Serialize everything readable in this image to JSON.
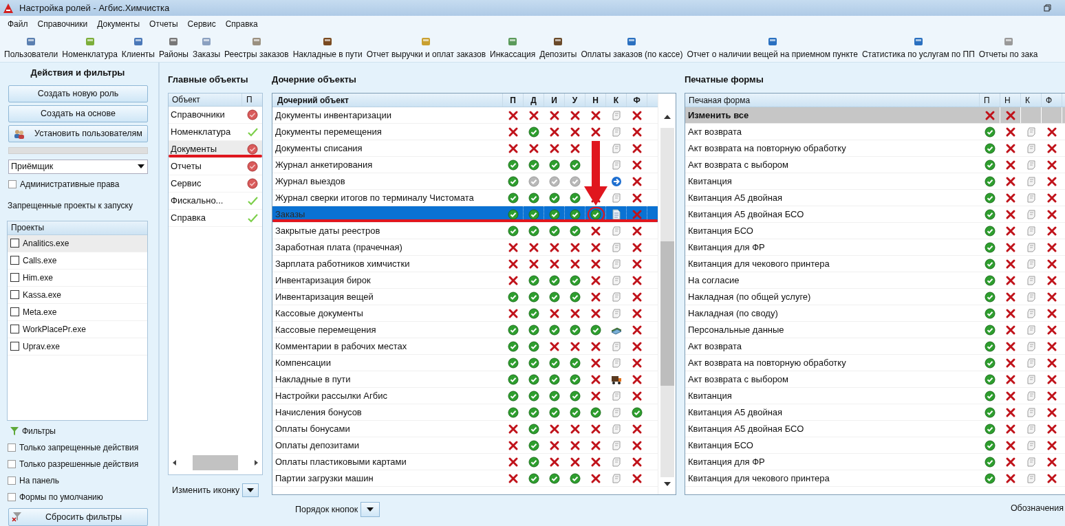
{
  "window": {
    "title": "Настройка ролей - Агбис.Химчистка"
  },
  "menu": [
    "Файл",
    "Справочники",
    "Документы",
    "Отчеты",
    "Сервис",
    "Справка"
  ],
  "toolbar": [
    "Пользователи",
    "Номенклатура",
    "Клиенты",
    "Районы",
    "Заказы",
    "Реестры заказов",
    "Накладные в пути",
    "Отчет выручки и оплат заказов",
    "Инкассация",
    "Депозиты",
    "Оплаты заказов (по кассе)",
    "Отчет о наличии вещей на приемном пункте",
    "Статистика по услугам по ПП",
    "Отчеты по зака"
  ],
  "actions_panel": {
    "title": "Действия и фильтры",
    "buttons": [
      {
        "label": "Создать новую роль",
        "kind": "plain"
      },
      {
        "label": "Создать на основе",
        "kind": "plain"
      },
      {
        "label": "Установить пользователям",
        "kind": "users"
      }
    ],
    "progress": {
      "level": 0
    },
    "role_select": {
      "value": "Приёмщик"
    },
    "admin_rights": {
      "label": "Административные права",
      "checked": false
    },
    "projects_label": "Запрещенные проекты к запуску",
    "projects": {
      "header": "Проекты",
      "items": [
        {
          "label": "Analitics.exe",
          "checked": false,
          "selected": true
        },
        {
          "label": "Calls.exe",
          "checked": false,
          "selected": false
        },
        {
          "label": "Him.exe",
          "checked": false,
          "selected": false
        },
        {
          "label": "Kassa.exe",
          "checked": false,
          "selected": false
        },
        {
          "label": "Meta.exe",
          "checked": false,
          "selected": false
        },
        {
          "label": "WorkPlacePr.exe",
          "checked": false,
          "selected": false
        },
        {
          "label": "Uprav.exe",
          "checked": false,
          "selected": false
        }
      ]
    },
    "filters": {
      "title": "Фильтры",
      "options": [
        {
          "label": "Только запрещенные действия",
          "checked": false
        },
        {
          "label": "Только разрешенные действия",
          "checked": false
        },
        {
          "label": "На панель",
          "checked": false
        },
        {
          "label": "Формы по умолчанию",
          "checked": false
        }
      ]
    },
    "reset_button": "Сбросить фильтры"
  },
  "main_objects": {
    "title": "Главные объекты",
    "columns": [
      "Объект",
      "П"
    ],
    "rows": [
      {
        "name": "Справочники",
        "allowed": false,
        "selected": false,
        "underlined": false
      },
      {
        "name": "Номенклатура",
        "allowed": true,
        "selected": false,
        "underlined": false
      },
      {
        "name": "Документы",
        "allowed": false,
        "selected": true,
        "underlined": true
      },
      {
        "name": "Отчеты",
        "allowed": false,
        "selected": false,
        "underlined": false
      },
      {
        "name": "Сервис",
        "allowed": false,
        "selected": false,
        "underlined": false
      },
      {
        "name": "Фискально...",
        "allowed": true,
        "selected": false,
        "underlined": false
      },
      {
        "name": "Справка",
        "allowed": true,
        "selected": false,
        "underlined": false
      }
    ],
    "change_icon_label": "Изменить иконку"
  },
  "child_objects": {
    "title": "Дочерние объекты",
    "columns": [
      "Дочерний объект",
      "П",
      "Д",
      "И",
      "У",
      "Н",
      "К",
      "Ф"
    ],
    "rows": [
      {
        "name": "Документы инвентаризации",
        "selected": false,
        "underlined": false,
        "cells": [
          {
            "kind": "no"
          },
          {
            "kind": "no"
          },
          {
            "kind": "no"
          },
          {
            "kind": "no"
          },
          {
            "kind": "no"
          },
          {
            "kind": "scroll"
          },
          {
            "kind": "no"
          }
        ]
      },
      {
        "name": "Документы перемещения",
        "selected": false,
        "underlined": false,
        "cells": [
          {
            "kind": "no"
          },
          {
            "kind": "yes"
          },
          {
            "kind": "no"
          },
          {
            "kind": "no"
          },
          {
            "kind": "no"
          },
          {
            "kind": "scroll"
          },
          {
            "kind": "no"
          }
        ]
      },
      {
        "name": "Документы списания",
        "selected": false,
        "underlined": false,
        "cells": [
          {
            "kind": "no"
          },
          {
            "kind": "no"
          },
          {
            "kind": "no"
          },
          {
            "kind": "no"
          },
          {
            "kind": "none"
          },
          {
            "kind": "scroll"
          },
          {
            "kind": "no"
          }
        ]
      },
      {
        "name": "Журнал анкетирования",
        "selected": false,
        "underlined": false,
        "cells": [
          {
            "kind": "yes"
          },
          {
            "kind": "yes"
          },
          {
            "kind": "yes"
          },
          {
            "kind": "yes"
          },
          {
            "kind": "none"
          },
          {
            "kind": "scroll"
          },
          {
            "kind": "no"
          }
        ]
      },
      {
        "name": "Журнал выездов",
        "selected": false,
        "underlined": false,
        "cells": [
          {
            "kind": "yes"
          },
          {
            "kind": "grey"
          },
          {
            "kind": "grey"
          },
          {
            "kind": "grey"
          },
          {
            "kind": "none"
          },
          {
            "kind": "arrow"
          },
          {
            "kind": "no"
          }
        ]
      },
      {
        "name": "Журнал сверки итогов по терминалу Чистомата",
        "selected": false,
        "underlined": false,
        "cells": [
          {
            "kind": "yes"
          },
          {
            "kind": "yes"
          },
          {
            "kind": "yes"
          },
          {
            "kind": "yes"
          },
          {
            "kind": "no"
          },
          {
            "kind": "scroll"
          },
          {
            "kind": "no"
          }
        ]
      },
      {
        "name": "Заказы",
        "selected": true,
        "underlined": true,
        "cells": [
          {
            "kind": "yes"
          },
          {
            "kind": "yes"
          },
          {
            "kind": "yes"
          },
          {
            "kind": "yes"
          },
          {
            "kind": "yes_marked"
          },
          {
            "kind": "doc"
          },
          {
            "kind": "no"
          }
        ]
      },
      {
        "name": "Закрытые даты реестров",
        "selected": false,
        "underlined": false,
        "cells": [
          {
            "kind": "yes"
          },
          {
            "kind": "yes"
          },
          {
            "kind": "yes"
          },
          {
            "kind": "yes"
          },
          {
            "kind": "no"
          },
          {
            "kind": "scroll"
          },
          {
            "kind": "no"
          }
        ]
      },
      {
        "name": "Заработная плата (прачечная)",
        "selected": false,
        "underlined": false,
        "cells": [
          {
            "kind": "no"
          },
          {
            "kind": "no"
          },
          {
            "kind": "no"
          },
          {
            "kind": "no"
          },
          {
            "kind": "no"
          },
          {
            "kind": "scroll"
          },
          {
            "kind": "no"
          }
        ]
      },
      {
        "name": "Зарплата работников химчистки",
        "selected": false,
        "underlined": false,
        "cells": [
          {
            "kind": "no"
          },
          {
            "kind": "no"
          },
          {
            "kind": "no"
          },
          {
            "kind": "no"
          },
          {
            "kind": "no"
          },
          {
            "kind": "scroll"
          },
          {
            "kind": "no"
          }
        ]
      },
      {
        "name": "Инвентаризация бирок",
        "selected": false,
        "underlined": false,
        "cells": [
          {
            "kind": "no"
          },
          {
            "kind": "yes"
          },
          {
            "kind": "yes"
          },
          {
            "kind": "yes"
          },
          {
            "kind": "no"
          },
          {
            "kind": "scroll"
          },
          {
            "kind": "no"
          }
        ]
      },
      {
        "name": "Инвентаризация вещей",
        "selected": false,
        "underlined": false,
        "cells": [
          {
            "kind": "yes"
          },
          {
            "kind": "yes"
          },
          {
            "kind": "yes"
          },
          {
            "kind": "yes"
          },
          {
            "kind": "no"
          },
          {
            "kind": "scroll"
          },
          {
            "kind": "no"
          }
        ]
      },
      {
        "name": "Кассовые документы",
        "selected": false,
        "underlined": false,
        "cells": [
          {
            "kind": "no"
          },
          {
            "kind": "yes"
          },
          {
            "kind": "no"
          },
          {
            "kind": "no"
          },
          {
            "kind": "no"
          },
          {
            "kind": "scroll"
          },
          {
            "kind": "no"
          }
        ]
      },
      {
        "name": "Кассовые перемещения",
        "selected": false,
        "underlined": false,
        "cells": [
          {
            "kind": "yes"
          },
          {
            "kind": "yes"
          },
          {
            "kind": "yes"
          },
          {
            "kind": "yes"
          },
          {
            "kind": "yes"
          },
          {
            "kind": "money"
          },
          {
            "kind": "no"
          }
        ]
      },
      {
        "name": "Комментарии в рабочих местах",
        "selected": false,
        "underlined": false,
        "cells": [
          {
            "kind": "yes"
          },
          {
            "kind": "yes"
          },
          {
            "kind": "no"
          },
          {
            "kind": "no"
          },
          {
            "kind": "no"
          },
          {
            "kind": "scroll"
          },
          {
            "kind": "no"
          }
        ]
      },
      {
        "name": "Компенсации",
        "selected": false,
        "underlined": false,
        "cells": [
          {
            "kind": "yes"
          },
          {
            "kind": "yes"
          },
          {
            "kind": "yes"
          },
          {
            "kind": "yes"
          },
          {
            "kind": "no"
          },
          {
            "kind": "scroll"
          },
          {
            "kind": "no"
          }
        ]
      },
      {
        "name": "Накладные в пути",
        "selected": false,
        "underlined": false,
        "cells": [
          {
            "kind": "yes"
          },
          {
            "kind": "yes"
          },
          {
            "kind": "yes"
          },
          {
            "kind": "yes"
          },
          {
            "kind": "no"
          },
          {
            "kind": "truck"
          },
          {
            "kind": "no"
          }
        ]
      },
      {
        "name": "Настройки рассылки Агбис",
        "selected": false,
        "underlined": false,
        "cells": [
          {
            "kind": "yes"
          },
          {
            "kind": "yes"
          },
          {
            "kind": "yes"
          },
          {
            "kind": "yes"
          },
          {
            "kind": "no"
          },
          {
            "kind": "scroll"
          },
          {
            "kind": "no"
          }
        ]
      },
      {
        "name": "Начисления бонусов",
        "selected": false,
        "underlined": false,
        "cells": [
          {
            "kind": "yes"
          },
          {
            "kind": "yes"
          },
          {
            "kind": "yes"
          },
          {
            "kind": "yes"
          },
          {
            "kind": "yes"
          },
          {
            "kind": "scroll"
          },
          {
            "kind": "yes"
          }
        ]
      },
      {
        "name": "Оплаты бонусами",
        "selected": false,
        "underlined": false,
        "cells": [
          {
            "kind": "no"
          },
          {
            "kind": "yes"
          },
          {
            "kind": "no"
          },
          {
            "kind": "no"
          },
          {
            "kind": "no"
          },
          {
            "kind": "scroll"
          },
          {
            "kind": "no"
          }
        ]
      },
      {
        "name": "Оплаты депозитами",
        "selected": false,
        "underlined": false,
        "cells": [
          {
            "kind": "no"
          },
          {
            "kind": "yes"
          },
          {
            "kind": "no"
          },
          {
            "kind": "no"
          },
          {
            "kind": "no"
          },
          {
            "kind": "scroll"
          },
          {
            "kind": "no"
          }
        ]
      },
      {
        "name": "Оплаты пластиковыми картами",
        "selected": false,
        "underlined": false,
        "cells": [
          {
            "kind": "no"
          },
          {
            "kind": "yes"
          },
          {
            "kind": "no"
          },
          {
            "kind": "no"
          },
          {
            "kind": "no"
          },
          {
            "kind": "scroll"
          },
          {
            "kind": "no"
          }
        ]
      },
      {
        "name": "Партии загрузки машин",
        "selected": false,
        "underlined": false,
        "cells": [
          {
            "kind": "no"
          },
          {
            "kind": "yes"
          },
          {
            "kind": "yes"
          },
          {
            "kind": "yes"
          },
          {
            "kind": "no"
          },
          {
            "kind": "scroll"
          },
          {
            "kind": "no"
          }
        ]
      }
    ],
    "button_order_label": "Порядок кнопок"
  },
  "print_forms": {
    "title": "Печатные формы",
    "columns": [
      "Печаная форма",
      "П",
      "Н",
      "К",
      "Ф"
    ],
    "rows": [
      {
        "name": "Изменить все",
        "kind": "all",
        "cells": [
          {
            "kind": "no"
          },
          {
            "kind": "no"
          },
          {
            "kind": "none"
          },
          {
            "kind": "none"
          }
        ]
      },
      {
        "name": "Акт возврата",
        "kind": "form",
        "cells": [
          {
            "kind": "yes"
          },
          {
            "kind": "no"
          },
          {
            "kind": "scroll"
          },
          {
            "kind": "no"
          }
        ]
      },
      {
        "name": "Акт возврата на повторную обработку",
        "kind": "form",
        "cells": [
          {
            "kind": "yes"
          },
          {
            "kind": "no"
          },
          {
            "kind": "scroll"
          },
          {
            "kind": "no"
          }
        ]
      },
      {
        "name": "Акт возврата с выбором",
        "kind": "form",
        "cells": [
          {
            "kind": "yes"
          },
          {
            "kind": "no"
          },
          {
            "kind": "scroll"
          },
          {
            "kind": "no"
          }
        ]
      },
      {
        "name": "Квитанция",
        "kind": "form",
        "cells": [
          {
            "kind": "yes"
          },
          {
            "kind": "no"
          },
          {
            "kind": "scroll"
          },
          {
            "kind": "no"
          }
        ]
      },
      {
        "name": "Квитанция А5 двойная",
        "kind": "form",
        "cells": [
          {
            "kind": "yes"
          },
          {
            "kind": "no"
          },
          {
            "kind": "scroll"
          },
          {
            "kind": "no"
          }
        ]
      },
      {
        "name": "Квитанция А5 двойная БСО",
        "kind": "form",
        "cells": [
          {
            "kind": "yes"
          },
          {
            "kind": "no"
          },
          {
            "kind": "scroll"
          },
          {
            "kind": "no"
          }
        ]
      },
      {
        "name": "Квитанция БСО",
        "kind": "form",
        "cells": [
          {
            "kind": "yes"
          },
          {
            "kind": "no"
          },
          {
            "kind": "scroll"
          },
          {
            "kind": "no"
          }
        ]
      },
      {
        "name": "Квитанция для ФР",
        "kind": "form",
        "cells": [
          {
            "kind": "yes"
          },
          {
            "kind": "no"
          },
          {
            "kind": "scroll"
          },
          {
            "kind": "no"
          }
        ]
      },
      {
        "name": "Квитанция для чекового принтера",
        "kind": "form",
        "cells": [
          {
            "kind": "yes"
          },
          {
            "kind": "no"
          },
          {
            "kind": "scroll"
          },
          {
            "kind": "no"
          }
        ]
      },
      {
        "name": "На согласие",
        "kind": "form",
        "cells": [
          {
            "kind": "yes"
          },
          {
            "kind": "no"
          },
          {
            "kind": "scroll"
          },
          {
            "kind": "no"
          }
        ]
      },
      {
        "name": "Накладная (по общей услуге)",
        "kind": "form",
        "cells": [
          {
            "kind": "yes"
          },
          {
            "kind": "no"
          },
          {
            "kind": "scroll"
          },
          {
            "kind": "no"
          }
        ]
      },
      {
        "name": "Накладная (по своду)",
        "kind": "form",
        "cells": [
          {
            "kind": "yes"
          },
          {
            "kind": "no"
          },
          {
            "kind": "scroll"
          },
          {
            "kind": "no"
          }
        ]
      },
      {
        "name": "Персональные данные",
        "kind": "form",
        "cells": [
          {
            "kind": "yes"
          },
          {
            "kind": "no"
          },
          {
            "kind": "scroll"
          },
          {
            "kind": "no"
          }
        ]
      },
      {
        "name": "Акт возврата",
        "kind": "form",
        "cells": [
          {
            "kind": "yes"
          },
          {
            "kind": "no"
          },
          {
            "kind": "scroll"
          },
          {
            "kind": "no"
          }
        ]
      },
      {
        "name": "Акт возврата на повторную обработку",
        "kind": "form",
        "cells": [
          {
            "kind": "yes"
          },
          {
            "kind": "no"
          },
          {
            "kind": "scroll"
          },
          {
            "kind": "no"
          }
        ]
      },
      {
        "name": "Акт возврата с выбором",
        "kind": "form",
        "cells": [
          {
            "kind": "yes"
          },
          {
            "kind": "no"
          },
          {
            "kind": "scroll"
          },
          {
            "kind": "no"
          }
        ]
      },
      {
        "name": "Квитанция",
        "kind": "form",
        "cells": [
          {
            "kind": "yes"
          },
          {
            "kind": "no"
          },
          {
            "kind": "scroll"
          },
          {
            "kind": "no"
          }
        ]
      },
      {
        "name": "Квитанция А5 двойная",
        "kind": "form",
        "cells": [
          {
            "kind": "yes"
          },
          {
            "kind": "no"
          },
          {
            "kind": "scroll"
          },
          {
            "kind": "no"
          }
        ]
      },
      {
        "name": "Квитанция А5 двойная БСО",
        "kind": "form",
        "cells": [
          {
            "kind": "yes"
          },
          {
            "kind": "no"
          },
          {
            "kind": "scroll"
          },
          {
            "kind": "no"
          }
        ]
      },
      {
        "name": "Квитанция БСО",
        "kind": "form",
        "cells": [
          {
            "kind": "yes"
          },
          {
            "kind": "no"
          },
          {
            "kind": "scroll"
          },
          {
            "kind": "no"
          }
        ]
      },
      {
        "name": "Квитанция для ФР",
        "kind": "form",
        "cells": [
          {
            "kind": "yes"
          },
          {
            "kind": "no"
          },
          {
            "kind": "scroll"
          },
          {
            "kind": "no"
          }
        ]
      },
      {
        "name": "Квитанция для чекового принтера",
        "kind": "form",
        "cells": [
          {
            "kind": "yes"
          },
          {
            "kind": "no"
          },
          {
            "kind": "scroll"
          },
          {
            "kind": "no"
          }
        ]
      }
    ],
    "legend_label": "Обозначения"
  }
}
